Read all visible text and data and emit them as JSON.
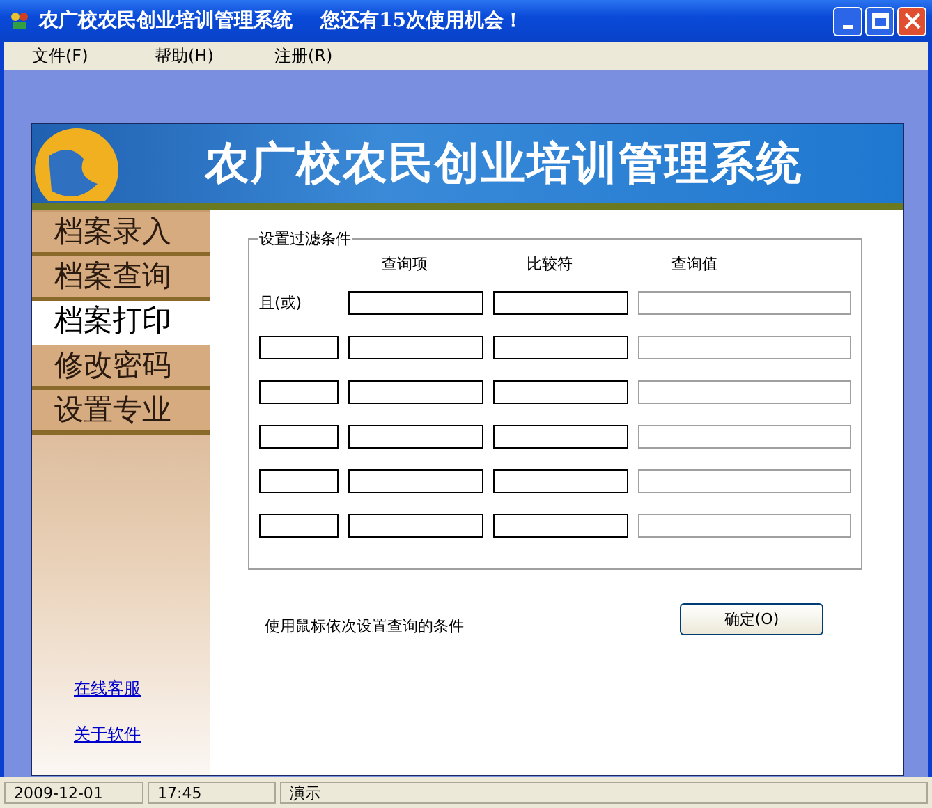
{
  "window": {
    "title": "农广校农民创业培训管理系统",
    "notice": "您还有15次使用机会！"
  },
  "menu": [
    {
      "label": "文件(F)"
    },
    {
      "label": "帮助(H)"
    },
    {
      "label": "注册(R)"
    }
  ],
  "banner": {
    "title": "农广校农民创业培训管理系统"
  },
  "sidebar": {
    "items": [
      {
        "label": "档案录入",
        "selected": false
      },
      {
        "label": "档案查询",
        "selected": false
      },
      {
        "label": "档案打印",
        "selected": true
      },
      {
        "label": "修改密码",
        "selected": false
      },
      {
        "label": "设置专业",
        "selected": false
      }
    ],
    "links": [
      "在线客服",
      "关于软件"
    ]
  },
  "filter": {
    "legend": "设置过滤条件",
    "columns": [
      "查询项",
      "比较符",
      "查询值"
    ],
    "rows": [
      {
        "kind": "first",
        "connector_label": "且(或)"
      },
      {
        "kind": "condition"
      },
      {
        "kind": "condition"
      },
      {
        "kind": "condition"
      },
      {
        "kind": "condition"
      },
      {
        "kind": "condition"
      }
    ]
  },
  "hint": "使用鼠标依次设置查询的条件",
  "ok_button": "确定(O)",
  "status_bar": [
    "2009-12-01",
    "17:45",
    "演示"
  ]
}
